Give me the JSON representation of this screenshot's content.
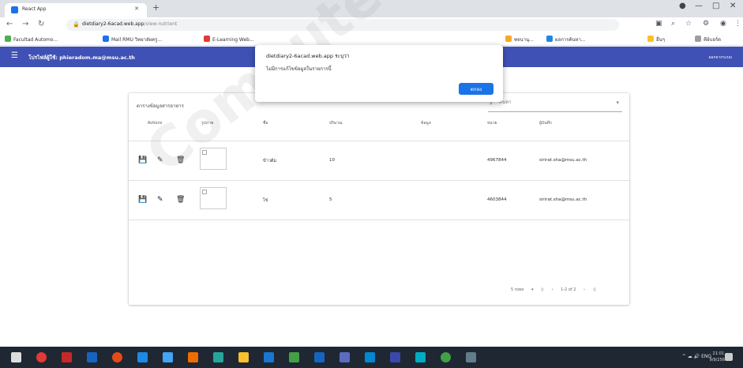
{
  "browser": {
    "tab_title": "React App",
    "url_host": "dietdiary2-6acad.web.app",
    "url_path": "/view-nutrient",
    "bookmarks": [
      {
        "label": "Facultad Automo...",
        "color": "#4caf50"
      },
      {
        "label": "Mail RMU วิทยาลัยครู...",
        "color": "#1a73e8"
      },
      {
        "label": "E-Learning Web...",
        "color": "#e53935"
      },
      {
        "label": "พจนานุ...",
        "color": "#f9a825"
      },
      {
        "label": "ผลการค้นหา...",
        "color": "#1e88e5"
      },
      {
        "label": "อื่นๆ",
        "color": "#fbc02d"
      },
      {
        "label": "คีย์บอร์ด",
        "color": "#9e9e9e"
      }
    ]
  },
  "appbar": {
    "menu_icon": "☰",
    "title": "โปรไฟล์ผู้ใช้: phieradom.ma@msu.ac.th",
    "right": "ออกจากระบบ"
  },
  "card": {
    "title": "ตารางข้อมูลสารอาหาร",
    "search_placeholder": "ค้นหา",
    "columns": [
      "Actions",
      "รูปภาพ",
      "ชื่อ",
      "ปริมาณ",
      "ข้อมูล",
      "หน่วย",
      "ผู้บันทึก"
    ],
    "rows": [
      {
        "name": "ข้าวต้ม",
        "qty": "10",
        "info": "",
        "unit": "4967844",
        "email": "sirirat.sha@msu.ac.th"
      },
      {
        "name": "ไข่",
        "qty": "5",
        "info": "",
        "unit": "4603844",
        "email": "sirirat.sha@msu.ac.th"
      }
    ],
    "pager": {
      "rows_label": "5 rows",
      "range": "1-2 of 2"
    }
  },
  "dialog": {
    "origin": "dietdiary2-6acad.web.app ระบุว่า",
    "message": "ไม่มีการแก้ไขข้อมูลในรายการนี้",
    "ok_label": "ตกลง"
  },
  "watermark": "Computer Science Department, Mahasarakham",
  "taskbar": {
    "tray": "^ ☁ 🔊 ENG",
    "time": "21:01",
    "date": "9/9/2564"
  }
}
